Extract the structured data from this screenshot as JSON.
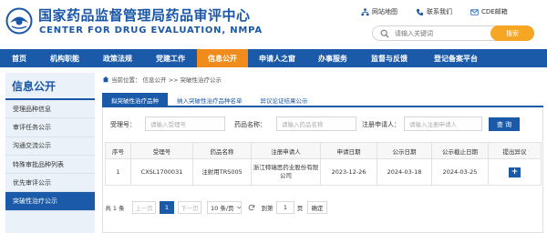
{
  "header": {
    "title_cn": "国家药品监督管理局药品审评中心",
    "title_en": "CENTER FOR DRUG EVALUATION, NMPA",
    "links": [
      {
        "label": "网站地图",
        "icon": "sitemap-icon"
      },
      {
        "label": "联系我们",
        "icon": "phone-icon"
      },
      {
        "label": "CDE邮箱",
        "icon": "mail-icon"
      }
    ],
    "search": {
      "placeholder": "请输入关键词",
      "button": "搜索"
    }
  },
  "nav": {
    "items": [
      "首页",
      "机构职能",
      "政策法规",
      "党建工作",
      "信息公开",
      "申请人之窗",
      "办事服务",
      "监督与反馈",
      "登记备案平台"
    ],
    "active": "信息公开"
  },
  "sidebar": {
    "title": "信息公开",
    "items": [
      "受理品种信息",
      "审评任务公示",
      "沟通交流公示",
      "特殊审批品种列表",
      "优先审评公示",
      "突破性治疗公示"
    ],
    "active": "突破性治疗公示"
  },
  "breadcrumb": {
    "prefix": "当前位置：",
    "path": "信息公开  >>  突破性治疗公示"
  },
  "tabs": [
    "拟突破性治疗品种",
    "纳入突破性治疗品种名单",
    "异议论证结果公示"
  ],
  "filter": {
    "fields": [
      {
        "label": "受理号：",
        "placeholder": "请输入受理号"
      },
      {
        "label": "药品名称：",
        "placeholder": "请输入药品名称"
      },
      {
        "label": "注册申请人：",
        "placeholder": "请输入注册申请人"
      }
    ],
    "button": "查 询"
  },
  "table": {
    "headers": [
      "序号",
      "受理号",
      "药品名称",
      "注册申请人",
      "申请日期",
      "公示日期",
      "公示截止日期",
      "提出异议"
    ],
    "rows": [
      [
        "1",
        "CXSL1700031",
        "注射用TRS005",
        "浙江特瑞思药业股份有限公司",
        "2023-12-26",
        "2024-03-18",
        "2024-03-25",
        "+"
      ]
    ]
  },
  "pager": {
    "total": "共 1 条",
    "prev": "上一页",
    "page": "1",
    "next": "下一页",
    "page_size": "10 条/页",
    "goto": "到第",
    "goto_value": "1",
    "goto_unit": "页",
    "confirm": "确定"
  },
  "colors": {
    "primary": "#1a5aa8",
    "accent": "#f08c1e",
    "search_button": "#f5a623"
  }
}
